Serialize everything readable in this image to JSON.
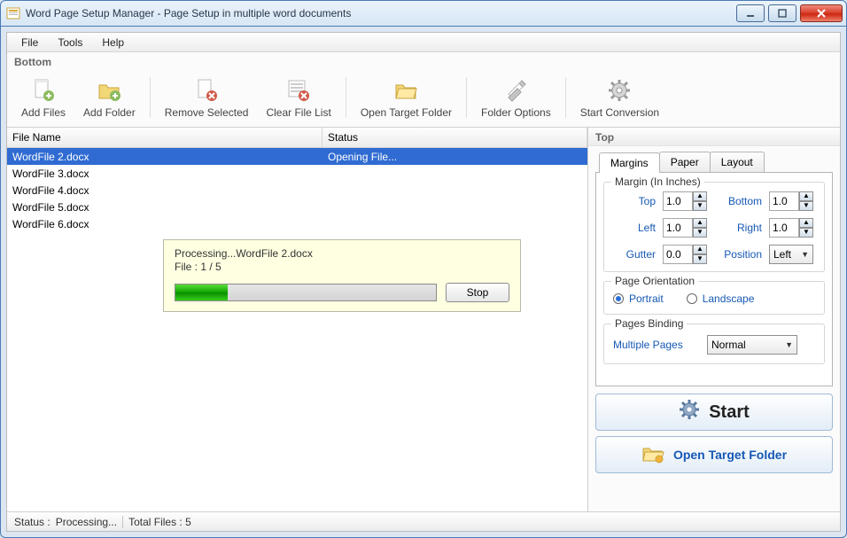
{
  "title": "Word Page Setup Manager - Page Setup in multiple word documents",
  "menu": {
    "file": "File",
    "tools": "Tools",
    "help": "Help"
  },
  "toolbar_section": "Bottom",
  "toolbar": {
    "add_files": "Add Files",
    "add_folder": "Add Folder",
    "remove_selected": "Remove Selected",
    "clear_list": "Clear File List",
    "open_target": "Open Target Folder",
    "folder_options": "Folder Options",
    "start_conv": "Start Conversion"
  },
  "table": {
    "col_filename": "File Name",
    "col_status": "Status",
    "rows": [
      {
        "name": "WordFile 2.docx",
        "status": "Opening File...",
        "selected": true
      },
      {
        "name": "WordFile 3.docx",
        "status": "",
        "selected": false
      },
      {
        "name": "WordFile 4.docx",
        "status": "",
        "selected": false
      },
      {
        "name": "WordFile 5.docx",
        "status": "",
        "selected": false
      },
      {
        "name": "WordFile 6.docx",
        "status": "",
        "selected": false
      }
    ]
  },
  "progress": {
    "line1": "Processing...WordFile 2.docx",
    "line2": "File : 1 / 5",
    "percent": 20,
    "stop": "Stop"
  },
  "right": {
    "section": "Top",
    "tabs": {
      "margins": "Margins",
      "paper": "Paper",
      "layout": "Layout",
      "active": "margins"
    },
    "margin_group": "Margin (In Inches)",
    "labels": {
      "top": "Top",
      "bottom": "Bottom",
      "left": "Left",
      "right": "Right",
      "gutter": "Gutter",
      "position": "Position"
    },
    "values": {
      "top": "1.0",
      "bottom": "1.0",
      "left": "1.0",
      "right": "1.0",
      "gutter": "0.0",
      "position": "Left"
    },
    "orient_group": "Page Orientation",
    "orient": {
      "portrait": "Portrait",
      "landscape": "Landscape",
      "selected": "portrait"
    },
    "binding_group": "Pages Binding",
    "binding": {
      "label": "Multiple Pages",
      "value": "Normal"
    },
    "start_btn": "Start",
    "open_btn": "Open Target Folder"
  },
  "status": {
    "label": "Status  :",
    "processing": "Processing...",
    "total": "Total Files : 5"
  }
}
